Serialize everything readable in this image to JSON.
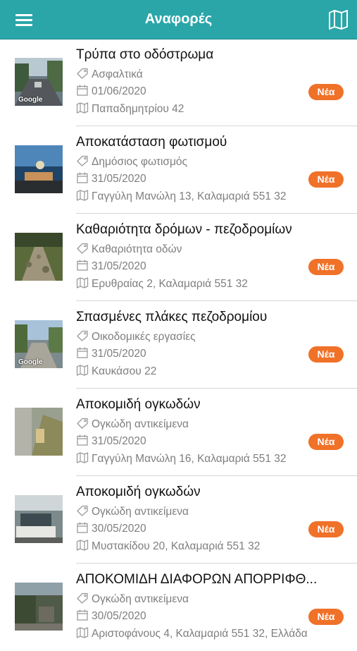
{
  "header": {
    "title": "Αναφορές",
    "menu_icon": "menu-icon",
    "map_icon": "map-icon",
    "color": "#2aa6a9"
  },
  "badge_color": "#f07128",
  "items": [
    {
      "title": "Τρύπα στο οδόστρωμα",
      "category": "Ασφαλτικά",
      "date": "01/06/2020",
      "address": "Παπαδημητρίου 42",
      "status": "Νέα",
      "watermark": "Google"
    },
    {
      "title": "Αποκατάσταση φωτισμού",
      "category": "Δημόσιος φωτισμός",
      "date": "31/05/2020",
      "address": "Γαγγύλη Μανώλη 13, Καλαμαριά 551 32",
      "status": "Νέα",
      "watermark": ""
    },
    {
      "title": "Καθαριότητα δρόμων - πεζοδρομίων",
      "category": "Καθαριότητα οδών",
      "date": "31/05/2020",
      "address": "Ερυθραίας 2, Καλαμαριά 551 32",
      "status": "Νέα",
      "watermark": ""
    },
    {
      "title": "Σπασμένες πλάκες πεζοδρομίου",
      "category": "Οικοδομικές εργασίες",
      "date": "31/05/2020",
      "address": "Καυκάσου 22",
      "status": "Νέα",
      "watermark": "Google"
    },
    {
      "title": "Αποκομιδή ογκωδών",
      "category": "Ογκώδη αντικείμενα",
      "date": "31/05/2020",
      "address": "Γαγγύλη Μανώλη 16, Καλαμαριά 551 32",
      "status": "Νέα",
      "watermark": ""
    },
    {
      "title": "Αποκομιδή ογκωδών",
      "category": "Ογκώδη αντικείμενα",
      "date": "30/05/2020",
      "address": "Μυστακίδου 20, Καλαμαριά 551 32",
      "status": "Νέα",
      "watermark": ""
    },
    {
      "title": "ΑΠΟΚΟΜΙΔΗ ΔΙΑΦΟΡΩΝ ΑΠΟΡΡΙΦΘ...",
      "category": "Ογκώδη αντικείμενα",
      "date": "30/05/2020",
      "address": "Αριστοφάνους 4, Καλαμαριά 551 32, Ελλάδα",
      "status": "Νέα",
      "watermark": ""
    }
  ]
}
